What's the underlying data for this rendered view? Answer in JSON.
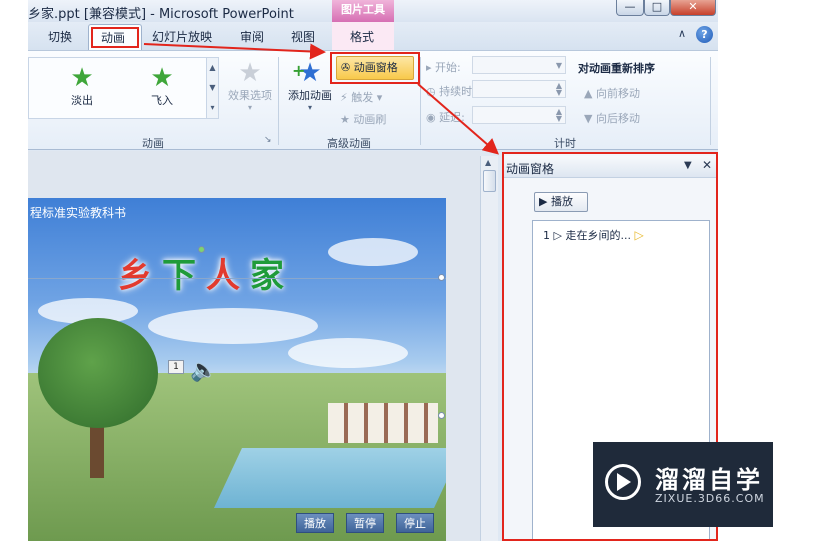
{
  "window": {
    "title": "乡家.ppt [兼容模式] - Microsoft PowerPoint",
    "context_tab": "图片工具",
    "min_glyph": "—",
    "max_glyph": "□",
    "close_glyph": "✕"
  },
  "tabs": {
    "items": [
      "切换",
      "动画",
      "幻灯片放映",
      "审阅",
      "视图",
      "格式"
    ],
    "active": "动画",
    "help_glyph": "?",
    "collapse_glyph": "∧"
  },
  "ribbon": {
    "animation_group": {
      "label": "动画",
      "effects": [
        "淡出",
        "飞入"
      ],
      "effect_options": "效果选项"
    },
    "advanced_group": {
      "label": "高级动画",
      "add_animation": "添加动画",
      "animation_pane": "动画窗格",
      "trigger": "触发",
      "animation_painter": "动画刷"
    },
    "timing_group": {
      "label": "计时",
      "start": "开始:",
      "duration": "持续时间:",
      "delay": "延迟:"
    },
    "reorder": {
      "title": "对动画重新排序",
      "move_earlier": "向前移动",
      "move_later": "向后移动"
    }
  },
  "slide": {
    "caption": "程标准实验教科书",
    "title_chars": [
      "乡",
      "下",
      "人",
      "家"
    ],
    "badge": "1",
    "buttons": {
      "play": "播放",
      "pause": "暂停",
      "stop": "停止"
    }
  },
  "animation_pane": {
    "title": "动画窗格",
    "play_label": "播放",
    "items": [
      {
        "index": "1",
        "name": "走在乡间的..."
      }
    ]
  },
  "watermark": {
    "title": "溜溜自学",
    "subtitle": "ZIXUE.3D66.COM"
  },
  "colors": {
    "highlight_red": "#e2251c",
    "pane_button_gold": "#f8c94b",
    "context_pink": "#d66fb3"
  }
}
